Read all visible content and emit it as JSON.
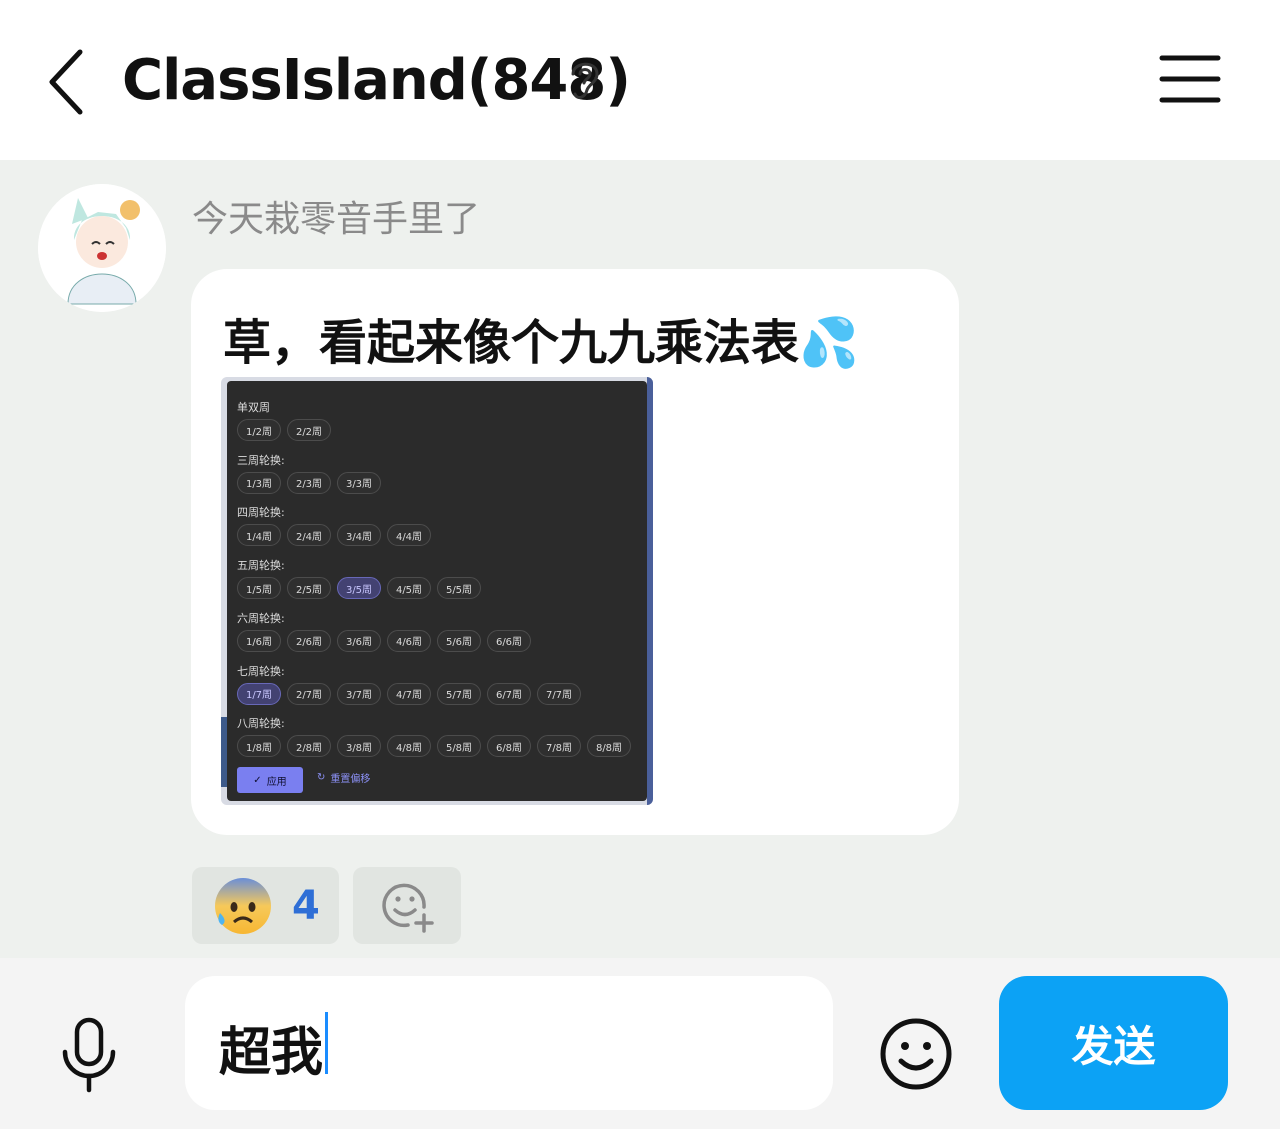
{
  "header": {
    "title": "ClassIsland(848)",
    "back_icon": "chevron-left-icon",
    "ear_icon": "ear-icon",
    "menu_icon": "hamburger-menu-icon"
  },
  "message": {
    "sender": "今天栽零音手里了",
    "text": "草，看起来像个九九乘法表💦",
    "screenshot": {
      "groups": [
        {
          "title": "单双周",
          "chips": [
            "1/2周",
            "2/2周"
          ],
          "selected": -1
        },
        {
          "title": "三周轮换:",
          "chips": [
            "1/3周",
            "2/3周",
            "3/3周"
          ],
          "selected": -1
        },
        {
          "title": "四周轮换:",
          "chips": [
            "1/4周",
            "2/4周",
            "3/4周",
            "4/4周"
          ],
          "selected": -1
        },
        {
          "title": "五周轮换:",
          "chips": [
            "1/5周",
            "2/5周",
            "3/5周",
            "4/5周",
            "5/5周"
          ],
          "selected": 2
        },
        {
          "title": "六周轮换:",
          "chips": [
            "1/6周",
            "2/6周",
            "3/6周",
            "4/6周",
            "5/6周",
            "6/6周"
          ],
          "selected": -1
        },
        {
          "title": "七周轮换:",
          "chips": [
            "1/7周",
            "2/7周",
            "3/7周",
            "4/7周",
            "5/7周",
            "6/7周",
            "7/7周"
          ],
          "selected": 0
        },
        {
          "title": "八周轮换:",
          "chips": [
            "1/8周",
            "2/8周",
            "3/8周",
            "4/8周",
            "5/8周",
            "6/8周",
            "7/8周",
            "8/8周"
          ],
          "selected": -1
        }
      ],
      "apply_label": "应用",
      "reset_label": "重置偏移"
    }
  },
  "reactions": {
    "emoji": "😰",
    "count": "4",
    "add_icon": "add-reaction-icon"
  },
  "input": {
    "value": "超我",
    "send_label": "发送",
    "mic_icon": "microphone-icon",
    "emoji_icon": "smiley-icon"
  },
  "colors": {
    "accent": "#0ca2f5",
    "count_blue": "#2f6fd6",
    "chat_bg": "#eef1ee"
  }
}
